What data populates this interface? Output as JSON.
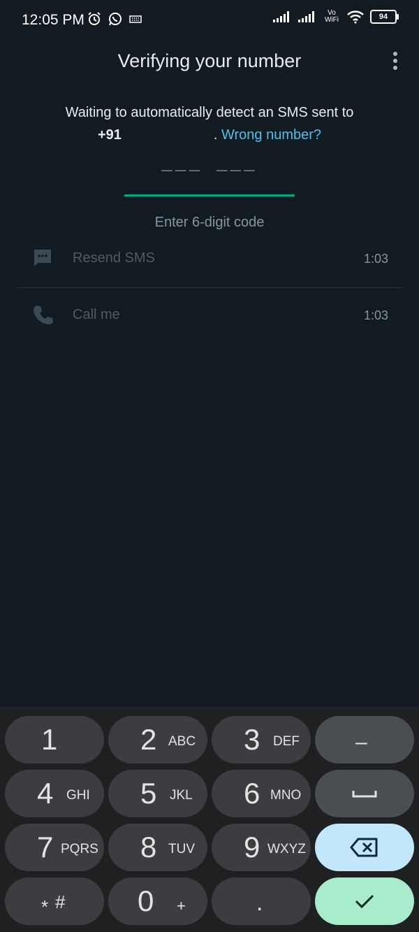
{
  "status": {
    "time": "12:05 PM",
    "network": "Vo WiFi",
    "battery": "94"
  },
  "header": {
    "title": "Verifying your number"
  },
  "verification": {
    "description": "Waiting to automatically detect an SMS sent to",
    "country_code": "+91",
    "separator": ".",
    "wrong_number": "Wrong number?",
    "code_placeholder": "––– –––",
    "code_hint": "Enter 6-digit code"
  },
  "options": [
    {
      "label": "Resend SMS",
      "timer": "1:03",
      "icon": "message-icon"
    },
    {
      "label": "Call me",
      "timer": "1:03",
      "icon": "phone-icon"
    }
  ],
  "keypad": {
    "keys": [
      {
        "digit": "1",
        "letters": ""
      },
      {
        "digit": "2",
        "letters": "ABC"
      },
      {
        "digit": "3",
        "letters": "DEF"
      },
      {
        "digit": "4",
        "letters": "GHI"
      },
      {
        "digit": "5",
        "letters": "JKL"
      },
      {
        "digit": "6",
        "letters": "MNO"
      },
      {
        "digit": "7",
        "letters": "PQRS"
      },
      {
        "digit": "8",
        "letters": "TUV"
      },
      {
        "digit": "9",
        "letters": "WXYZ"
      },
      {
        "digit": "*",
        "letters": "#"
      },
      {
        "digit": "0",
        "letters": "+"
      },
      {
        "digit": ".",
        "letters": ""
      }
    ],
    "dash": "–"
  },
  "colors": {
    "accent": "#00a884",
    "link": "#53bdeb",
    "background": "#111b21",
    "backspace_key": "#c3e7fa",
    "done_key": "#a8eccb"
  }
}
